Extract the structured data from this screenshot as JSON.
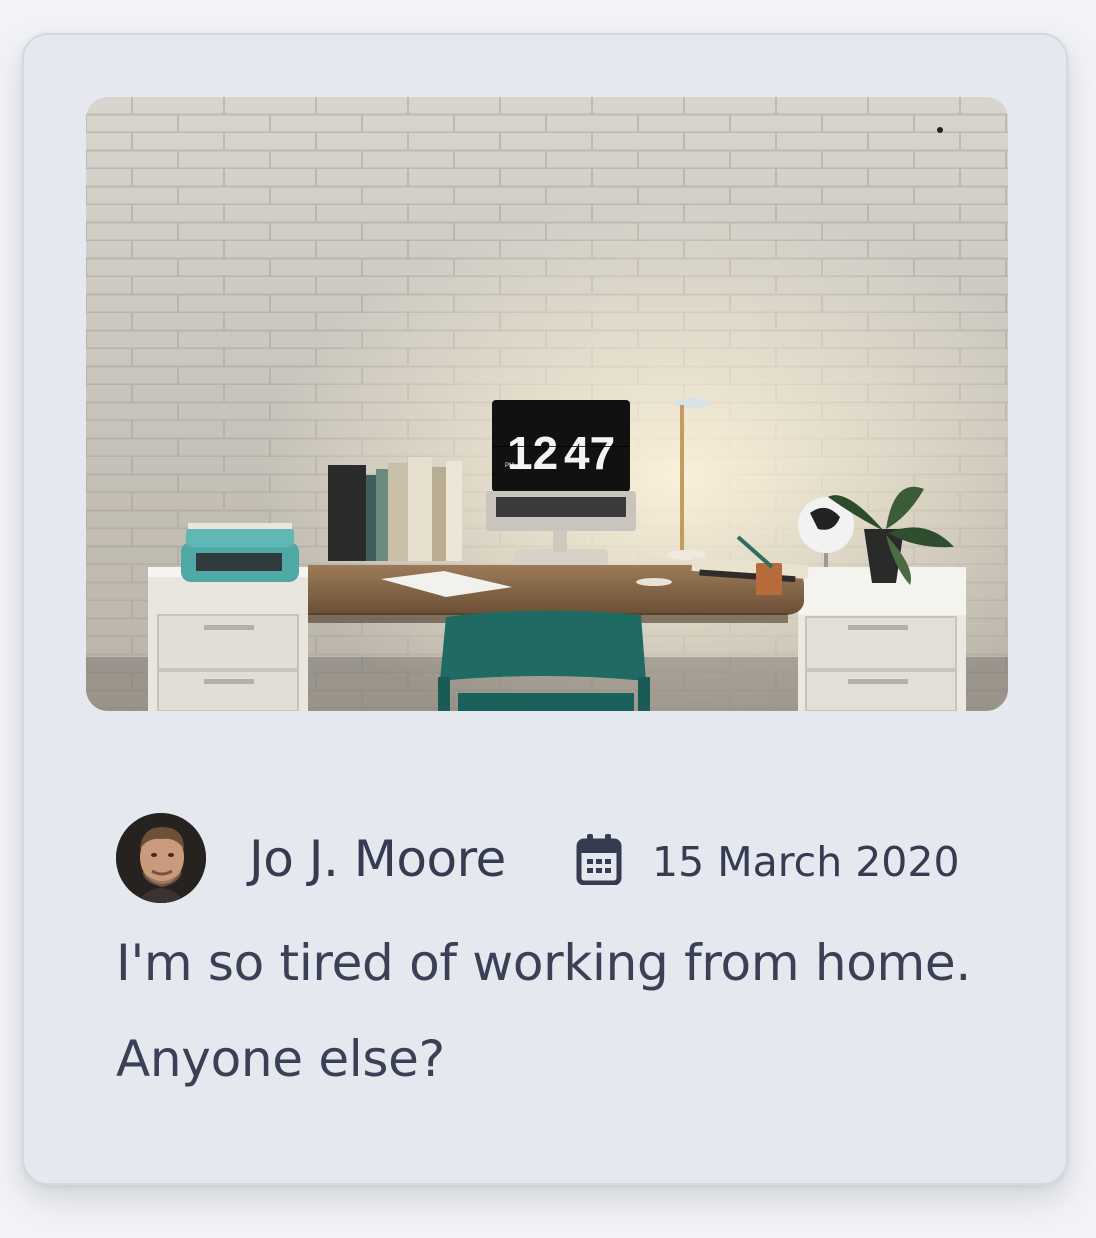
{
  "post": {
    "image_alt": "Home office desk with laptop showing 12:47 against a white brick wall",
    "clock_hours": "12",
    "clock_minutes": "47",
    "clock_period": "PM",
    "author": "Jo J. Moore",
    "date": "15 March 2020",
    "text": "I'm so tired of working from home. Anyone else?"
  },
  "icons": {
    "date": "calendar-icon",
    "avatar": "avatar"
  },
  "colors": {
    "card_bg": "#e6e8ef",
    "text": "#353b50",
    "page_bg": "#f2f3f6"
  }
}
